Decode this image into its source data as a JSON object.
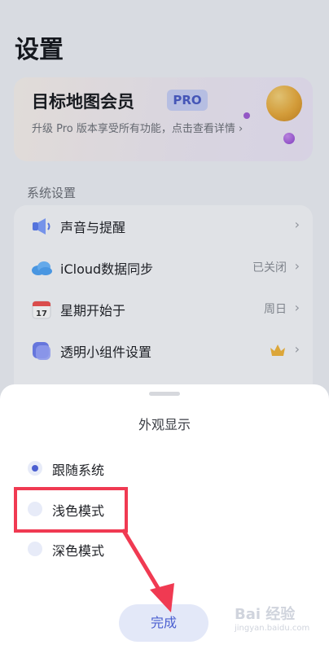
{
  "page": {
    "title": "设置"
  },
  "vip": {
    "title": "目标地图会员",
    "badge": "PRO",
    "description": "升级 Pro 版本享受所有功能，点击查看详情 ›"
  },
  "section": {
    "label": "系统设置"
  },
  "settings": [
    {
      "label": "声音与提醒",
      "value": "",
      "icon": "speaker-icon"
    },
    {
      "label": "iCloud数据同步",
      "value": "已关闭",
      "icon": "cloud-icon"
    },
    {
      "label": "星期开始于",
      "value": "周日",
      "icon": "calendar-icon",
      "icon_text": "17"
    },
    {
      "label": "透明小组件设置",
      "value": "",
      "icon": "widget-icon",
      "badge_icon": "crown-icon"
    }
  ],
  "sheet": {
    "title": "外观显示",
    "options": [
      {
        "label": "跟随系统",
        "selected": true
      },
      {
        "label": "浅色模式",
        "selected": false
      },
      {
        "label": "深色模式",
        "selected": false
      }
    ],
    "done_label": "完成"
  },
  "watermark": {
    "text": "Bai 经验",
    "subtext": "jingyan.baidu.com"
  },
  "colors": {
    "accent": "#4b5fd0",
    "annotation": "#f03a52",
    "badge_bg": "#c8d0f6"
  }
}
